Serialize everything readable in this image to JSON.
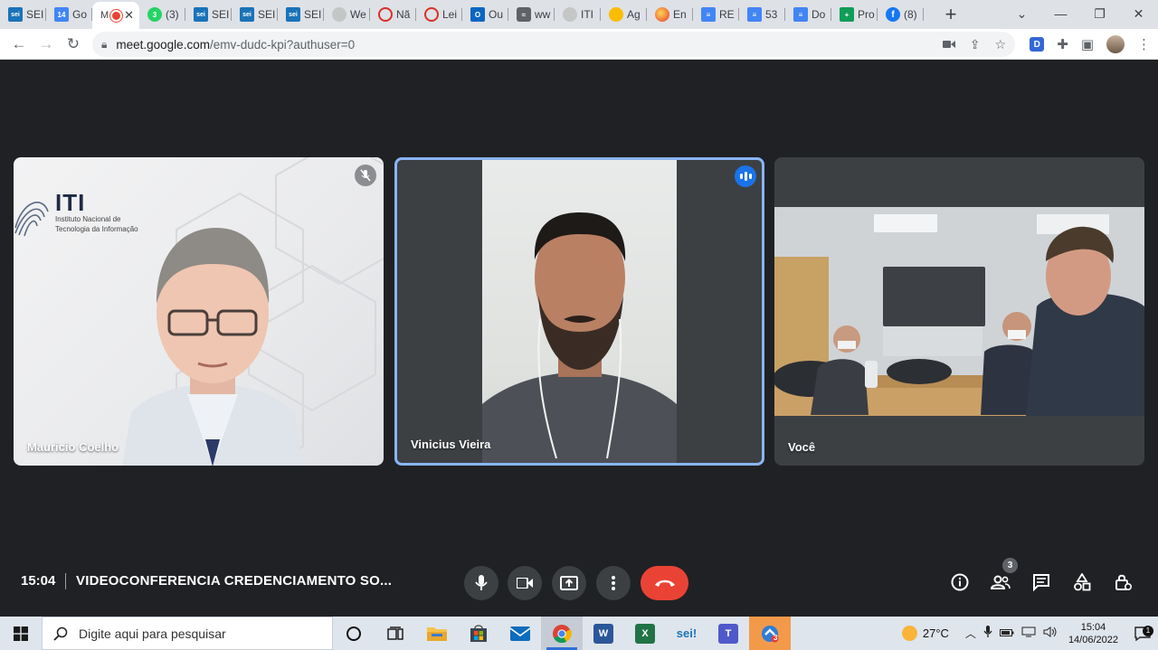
{
  "browser": {
    "tabs": [
      {
        "icon": "sei-icon",
        "label": "SEI"
      },
      {
        "icon": "calendar-icon",
        "label": "Go"
      },
      {
        "icon": "meet-recording-icon",
        "label": "M",
        "active": true
      },
      {
        "icon": "whatsapp-icon",
        "label": "(3)",
        "badge": "3"
      },
      {
        "icon": "sei-icon",
        "label": "SEI"
      },
      {
        "icon": "sei-icon",
        "label": "SEI"
      },
      {
        "icon": "sei-icon",
        "label": "SEI"
      },
      {
        "icon": "globe-icon",
        "label": "We"
      },
      {
        "icon": "circle-red-icon",
        "label": "Nã"
      },
      {
        "icon": "circle-red-icon",
        "label": "Lei"
      },
      {
        "icon": "outlook-icon",
        "label": "Ou"
      },
      {
        "icon": "wave-icon",
        "label": "ww"
      },
      {
        "icon": "globe-icon",
        "label": "ITI"
      },
      {
        "icon": "agenda-icon",
        "label": "Ag"
      },
      {
        "icon": "orange-circle-icon",
        "label": "En"
      },
      {
        "icon": "docs-icon",
        "label": "RE"
      },
      {
        "icon": "docs-icon",
        "label": "53"
      },
      {
        "icon": "docs-icon",
        "label": "Do"
      },
      {
        "icon": "sheets-icon",
        "label": "Pro"
      },
      {
        "icon": "facebook-icon",
        "label": "(8)"
      }
    ],
    "url_host": "meet.google.com",
    "url_path": "/emv-dudc-kpi?authuser=0",
    "extension_label": "D"
  },
  "meet": {
    "participants": [
      {
        "name": "Mauricio Coelho",
        "muted": true,
        "logo_title": "ITI",
        "logo_line1": "Instituto Nacional de",
        "logo_line2": "Tecnologia da Informação"
      },
      {
        "name": "Vinicius Vieira",
        "speaking": true
      },
      {
        "name": "Você"
      }
    ],
    "time": "15:04",
    "meeting_title": "VIDEOCONFERENCIA CREDENCIAMENTO SO...",
    "people_count": "3",
    "colors": {
      "background": "#202124",
      "tile": "#3c4043",
      "end_call": "#ea4335",
      "active_border": "#8ab4f8",
      "speaking": "#1a73e8"
    }
  },
  "taskbar": {
    "search_placeholder": "Digite aqui para pesquisar",
    "temperature": "27°C",
    "clock_time": "15:04",
    "clock_date": "14/06/2022",
    "notifications": "1",
    "apps": [
      {
        "icon": "cortana-icon"
      },
      {
        "icon": "task-view-icon"
      },
      {
        "icon": "file-explorer-icon"
      },
      {
        "icon": "store-icon"
      },
      {
        "icon": "mail-icon"
      },
      {
        "icon": "chrome-icon",
        "active": true
      },
      {
        "icon": "word-icon",
        "label": "W"
      },
      {
        "icon": "excel-icon",
        "label": "X"
      },
      {
        "icon": "sei-app-icon",
        "label": "sei!"
      },
      {
        "icon": "teams-icon",
        "label": "T"
      },
      {
        "icon": "anydesk-icon",
        "badge": "3"
      }
    ]
  }
}
